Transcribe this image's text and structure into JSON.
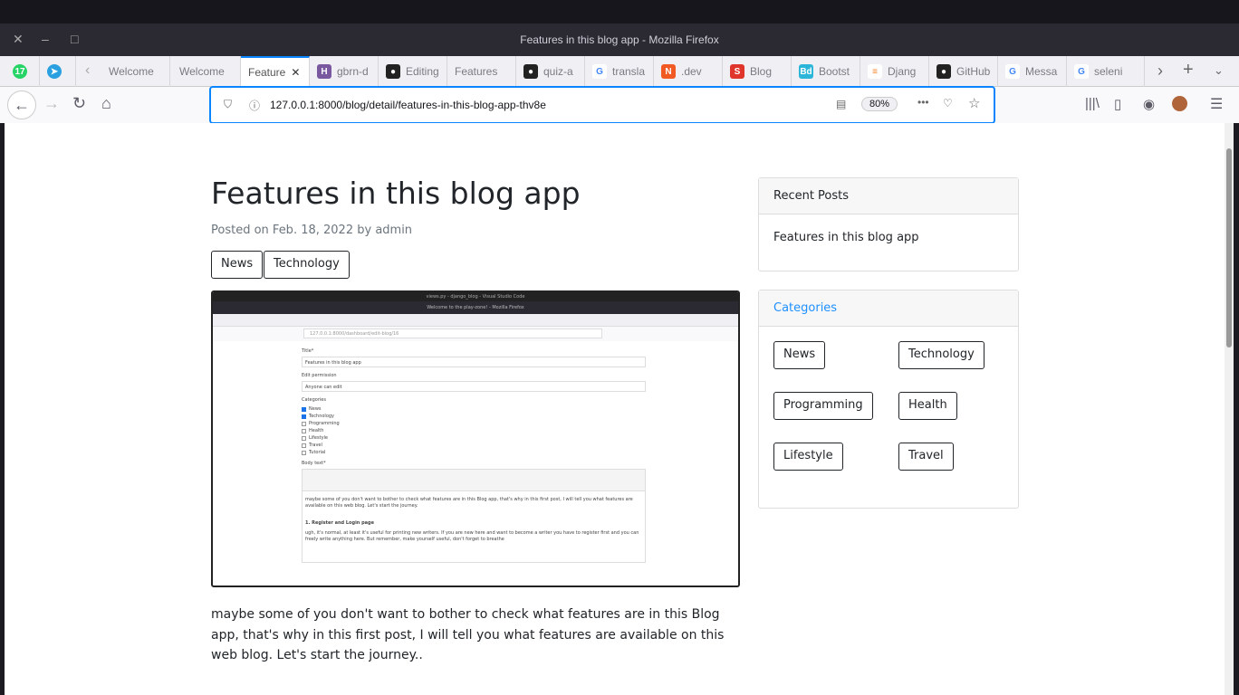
{
  "window": {
    "title": "Features in this blog app - Mozilla Firefox"
  },
  "tabs": [
    {
      "label": "Welcome",
      "icon": "none"
    },
    {
      "label": "Welcome",
      "icon": "none"
    },
    {
      "label": "Feature",
      "icon": "none",
      "active": true
    },
    {
      "label": "gbrn-d",
      "icon": "heroku-icon"
    },
    {
      "label": "Editing",
      "icon": "github-icon"
    },
    {
      "label": "Features",
      "icon": "none"
    },
    {
      "label": "quiz-a",
      "icon": "github-icon"
    },
    {
      "label": "transla",
      "icon": "google-icon"
    },
    {
      "label": ".dev",
      "icon": "dev-icon"
    },
    {
      "label": "Blog",
      "icon": "s-icon"
    },
    {
      "label": "Bootst",
      "icon": "bd-icon"
    },
    {
      "label": "Djang",
      "icon": "stackoverflow-icon"
    },
    {
      "label": "GitHub",
      "icon": "github-icon"
    },
    {
      "label": "Messa",
      "icon": "google-icon"
    },
    {
      "label": "seleni",
      "icon": "google-icon"
    }
  ],
  "pinned": {
    "whatsapp_badge": "17"
  },
  "toolbar": {
    "url": "127.0.0.1:8000/blog/detail/features-in-this-blog-app-thv8e",
    "zoom": "80%"
  },
  "post": {
    "title": "Features in this blog app",
    "posted_prefix": "Posted on ",
    "date": "Feb. 18, 2022",
    "by": " by ",
    "author": "admin",
    "tags": [
      "News",
      "Technology"
    ],
    "body": "maybe some of you don't want to bother to check what features are in this Blog app, that's why in this first post, I will tell you what features are available on this web blog. Let's start the journey.."
  },
  "screenshot": {
    "window_title": "Welcome to the play-zone! - Mozilla Firefox",
    "vscode_title": "views.py - django_blog - Visual Studio Code",
    "url": "127.0.0.1:8000/dashboard/edit-blog/16",
    "title_label": "Title*",
    "title_value": "Features in this blog app",
    "perm_label": "Edit permission",
    "perm_value": "Anyone can edit",
    "cat_label": "Categories",
    "cats": [
      {
        "name": "News",
        "checked": true
      },
      {
        "name": "Technology",
        "checked": true
      },
      {
        "name": "Programming",
        "checked": false
      },
      {
        "name": "Health",
        "checked": false
      },
      {
        "name": "Lifestyle",
        "checked": false
      },
      {
        "name": "Travel",
        "checked": false
      },
      {
        "name": "Tutorial",
        "checked": false
      }
    ],
    "body_label": "Body text*",
    "body_p1": "maybe some of you don't want to bother to check what features are in this Blog app, that's why in this first post, I will tell you what features are available on this web blog. Let's start the journey.",
    "body_h": "1. Register and Login page",
    "body_p2": "ugh, it's normal, at least it's useful for printing new writers. If you are new here and want to become a writer you have to register first and you can freely write anything here. But remember, make yourself useful, don't forget to breathe"
  },
  "sidebar": {
    "recent_title": "Recent Posts",
    "recent": [
      "Features in this blog app"
    ],
    "cat_title": "Categories",
    "categories": [
      "News",
      "Technology",
      "Programming",
      "Health",
      "Lifestyle",
      "Travel"
    ]
  },
  "colors": {
    "accent": "#0a84ff",
    "link": "#1e90ff"
  }
}
